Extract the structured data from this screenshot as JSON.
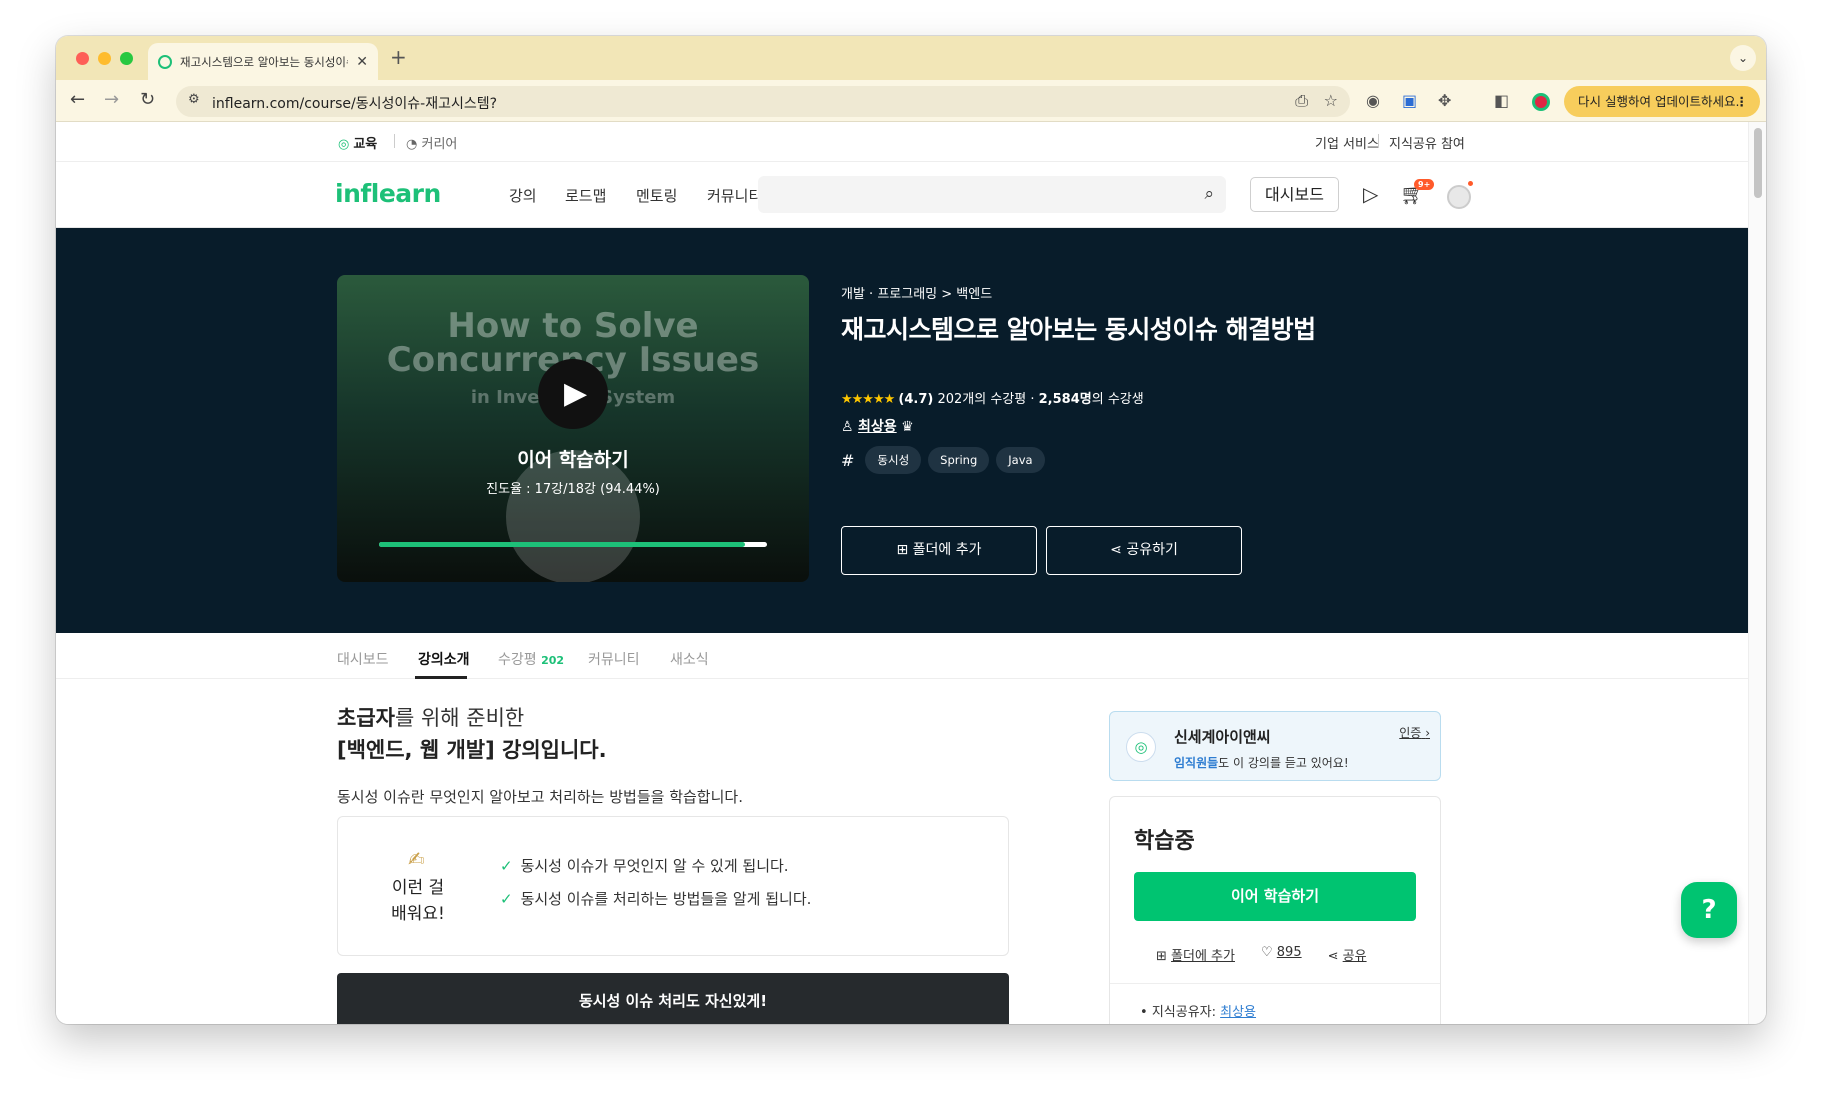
{
  "browser": {
    "tab_title": "재고시스템으로 알아보는 동시성이슈",
    "url": "inflearn.com/course/동시성이슈-재고시스템?",
    "update_label": "다시 실행하여 업데이트하세요.",
    "colors": {
      "tabstrip": "#f2e6b7",
      "toolbar": "#fbf6e3",
      "update_pill": "#f7cd5c"
    }
  },
  "util_bar": {
    "edu": "교육",
    "career": "커리어",
    "business": "기업 서비스",
    "share_knowledge": "지식공유 참여"
  },
  "gnb": {
    "logo": "inflearn",
    "menu": [
      "강의",
      "로드맵",
      "멘토링",
      "커뮤니티"
    ],
    "dashboard": "대시보드",
    "cart_badge": "9+",
    "brand_color": "#1dc078"
  },
  "hero": {
    "thumbnail_title_line1": "How to Solve",
    "thumbnail_title_line2": "Concurrency Issues",
    "thumbnail_subtitle": "in Inventory System",
    "continue_label": "이어 학습하기",
    "progress_text": "진도율 : 17강/18강 (94.44%)",
    "progress_fraction": 0.9444,
    "breadcrumb": "개발 · 프로그래밍 > 백엔드",
    "title": "재고시스템으로 알아보는 동시성이슈 해결방법",
    "stars": "★★★★★",
    "rating": "(4.7)",
    "review_count": "202개의 수강평",
    "students_count": "2,584명",
    "students_suffix": "의 수강생",
    "instructor": "최상용",
    "tags": [
      "동시성",
      "Spring",
      "Java"
    ],
    "add_folder": "폴더에 추가",
    "share": "공유하기"
  },
  "tabs": {
    "items": [
      {
        "label": "대시보드"
      },
      {
        "label": "강의소개"
      },
      {
        "label": "수강평",
        "count": "202"
      },
      {
        "label": "커뮤니티"
      },
      {
        "label": "새소식"
      }
    ]
  },
  "content": {
    "intro_bold": "초급자",
    "intro_rest": "를 위해 준비한",
    "intro2": "[백엔드, 웹 개발] 강의입니다.",
    "description": "동시성 이슈란 무엇인지 알아보고 처리하는 방법들을 학습합니다.",
    "learn_emoji": "✍",
    "learn_label": "이런 걸 배워요!",
    "learn_items": [
      "동시성 이슈가 무엇인지 알 수 있게 됩니다.",
      "동시성 이슈를 처리하는 방법들을 알게 됩니다."
    ],
    "banner": "동시성 이슈 처리도 자신있게!"
  },
  "sidebar": {
    "company_name": "신세계아이앤씨",
    "company_highlight": "임직원들",
    "company_suffix": "도 이 강의를 듣고 있어요!",
    "company_auth": "인증",
    "status": "학습중",
    "cta": "이어 학습하기",
    "folder": "폴더에 추가",
    "likes": "895",
    "share": "공유",
    "owner_label": "지식공유자: ",
    "owner_name": "최상용"
  }
}
